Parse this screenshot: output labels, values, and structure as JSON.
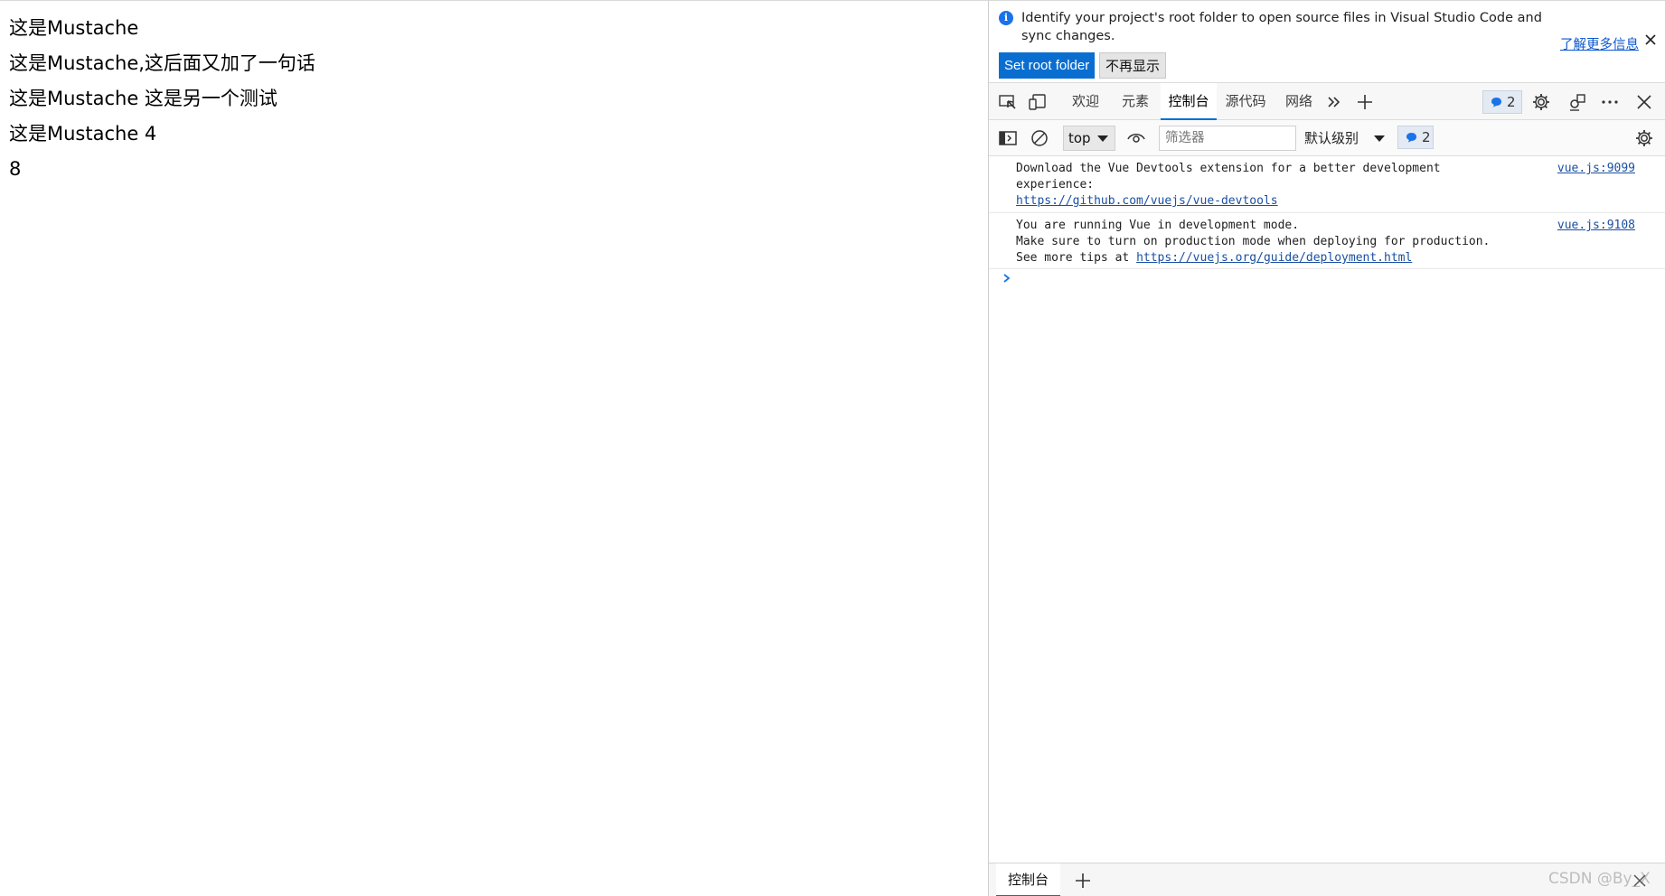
{
  "page": {
    "lines": [
      "这是Mustache",
      "这是Mustache,这后面又加了一句话",
      "这是Mustache 这是另一个测试",
      "这是Mustache 4",
      "8"
    ]
  },
  "devtools": {
    "infobar": {
      "message": "Identify your project's root folder to open source files in Visual Studio Code and sync changes.",
      "learn_more": "了解更多信息",
      "set_root_label": "Set root folder",
      "dont_show_label": "不再显示"
    },
    "tabs": [
      "欢迎",
      "元素",
      "控制台",
      "源代码",
      "网络"
    ],
    "active_tab": "控制台",
    "issue_count": "2",
    "toolbar": {
      "context": "top",
      "filter_placeholder": "筛选器",
      "levels": "默认级别",
      "message_count": "2"
    },
    "logs": [
      {
        "lines": [
          "Download the Vue Devtools extension for a better development",
          "experience:"
        ],
        "link": "https://github.com/vuejs/vue-devtools",
        "source": "vue.js:9099"
      },
      {
        "lines": [
          "You are running Vue in development mode.",
          "Make sure to turn on production mode when deploying for production."
        ],
        "tip_prefix": "See more tips at ",
        "link": "https://vuejs.org/guide/deployment.html",
        "source": "vue.js:9108"
      }
    ],
    "drawer": {
      "tab": "控制台",
      "watermark": "CSDN @By_X"
    },
    "colors": {
      "accent": "#0a6ed1",
      "link": "#1a4fa3",
      "info_icon": "#1a73e8"
    }
  }
}
